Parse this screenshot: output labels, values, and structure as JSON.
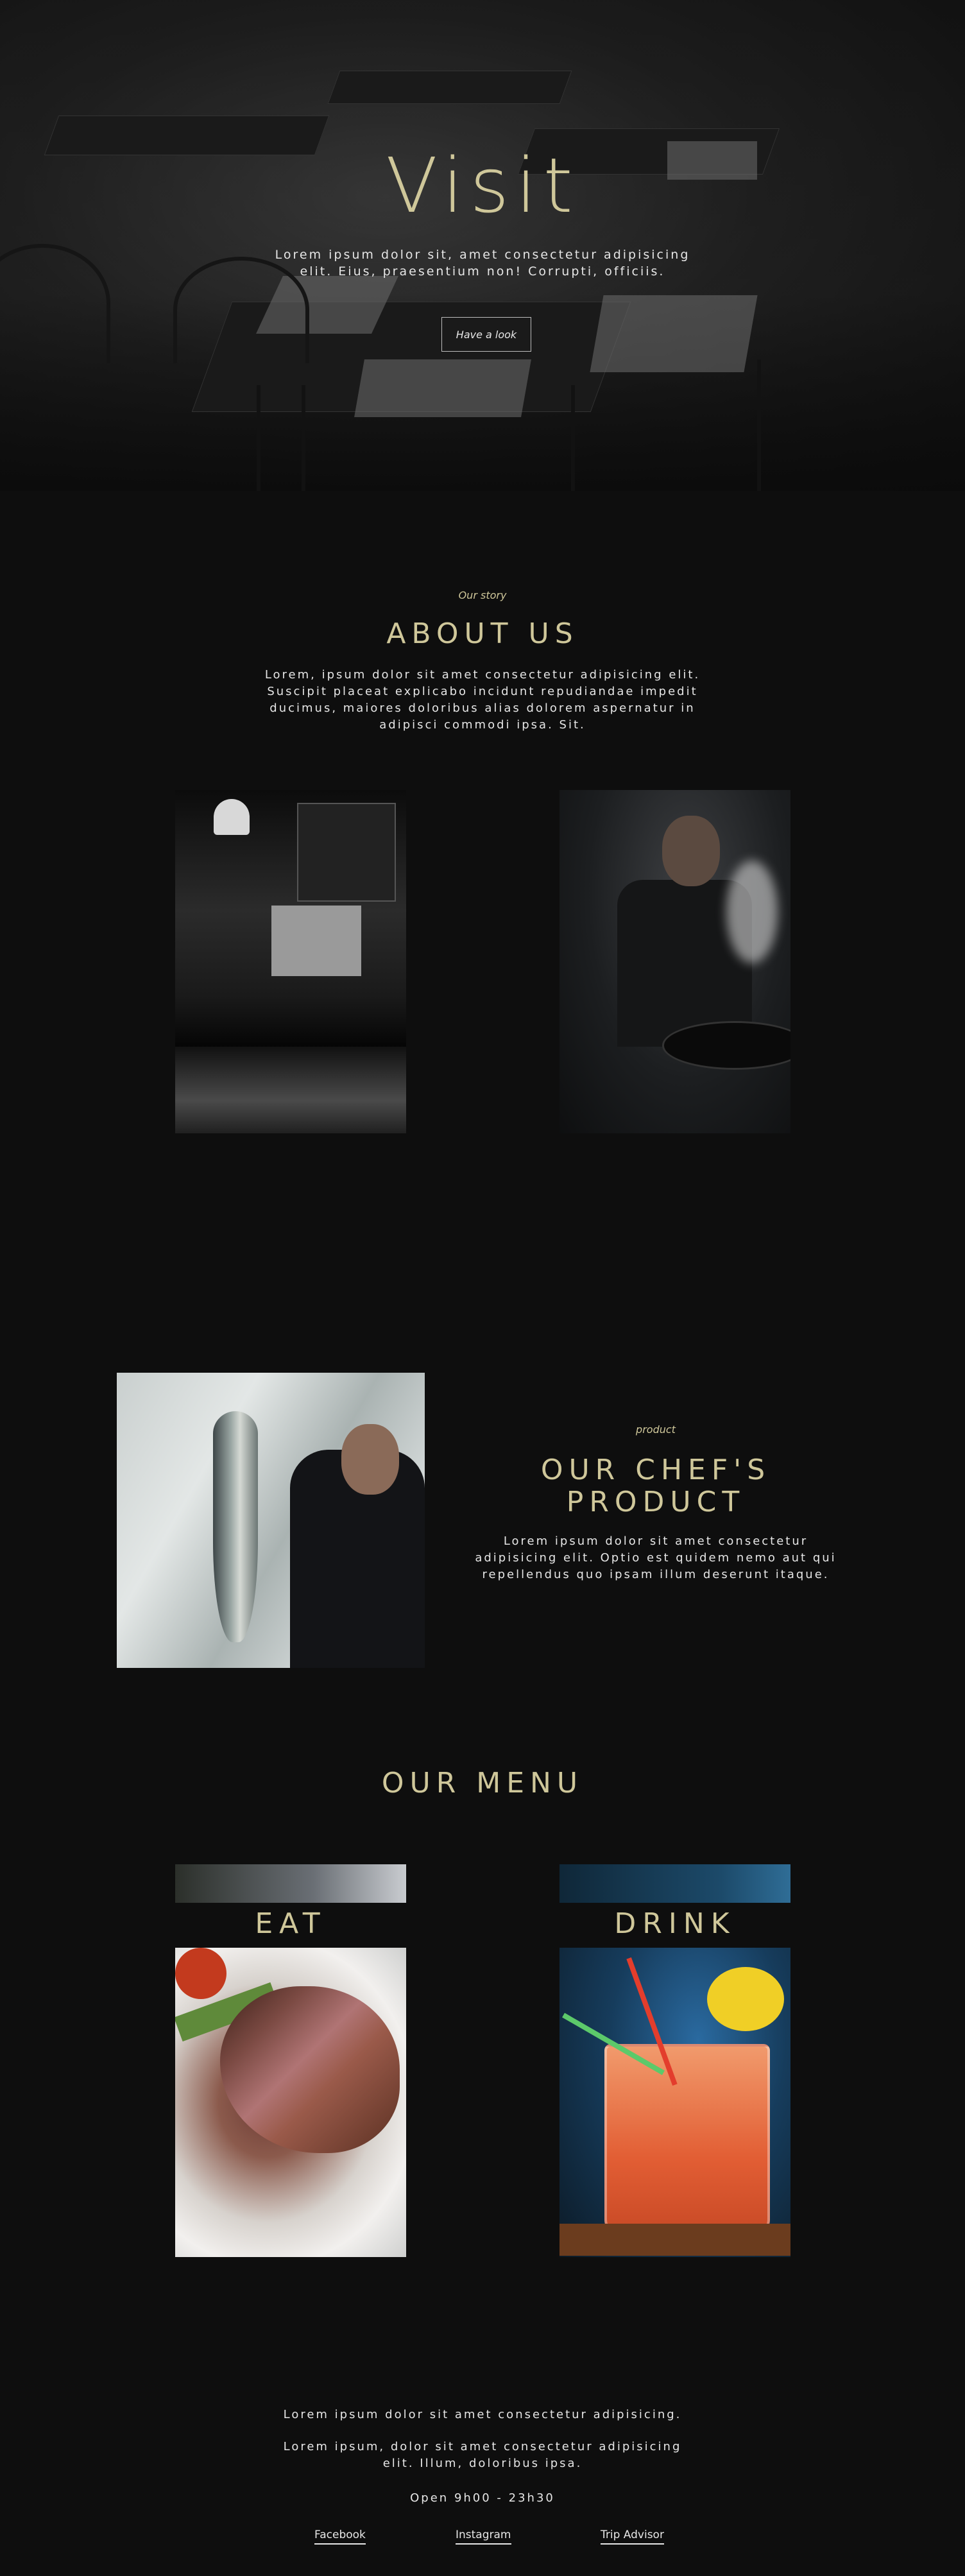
{
  "hero": {
    "title": "Visit",
    "text": "Lorem ipsum dolor sit, amet consectetur adipisicing elit. Eius, praesentium non! Corrupti, officiis.",
    "button": "Have a look"
  },
  "about": {
    "kicker": "Our story",
    "title": "ABOUT US",
    "text": "Lorem, ipsum dolor sit amet consectetur adipisicing elit. Suscipit placeat explicabo incidunt repudiandae impedit ducimus, maiores doloribus alias dolorem aspernatur in adipisci commodi ipsa. Sit."
  },
  "product": {
    "kicker": "product",
    "title_line1": "OUR CHEF'S",
    "title_line2": "PRODUCT",
    "text": "Lorem ipsum dolor sit amet consectetur adipisicing elit. Optio est quidem nemo aut qui repellendus quo ipsam illum deserunt itaque."
  },
  "menu": {
    "title": "OUR MENU",
    "eat": "EAT",
    "drink": "DRINK"
  },
  "footer": {
    "line1": "Lorem ipsum dolor sit amet consectetur adipisicing.",
    "line2": "Lorem ipsum, dolor sit amet consectetur adipisicing elit. Illum, doloribus ipsa.",
    "hours": "Open 9h00 - 23h30",
    "links": [
      "Facebook",
      "Instagram",
      "Trip Advisor"
    ]
  },
  "colors": {
    "background": "#0e0e0e",
    "accent_gold": "#cfc79a",
    "text": "#e6e6e6"
  }
}
